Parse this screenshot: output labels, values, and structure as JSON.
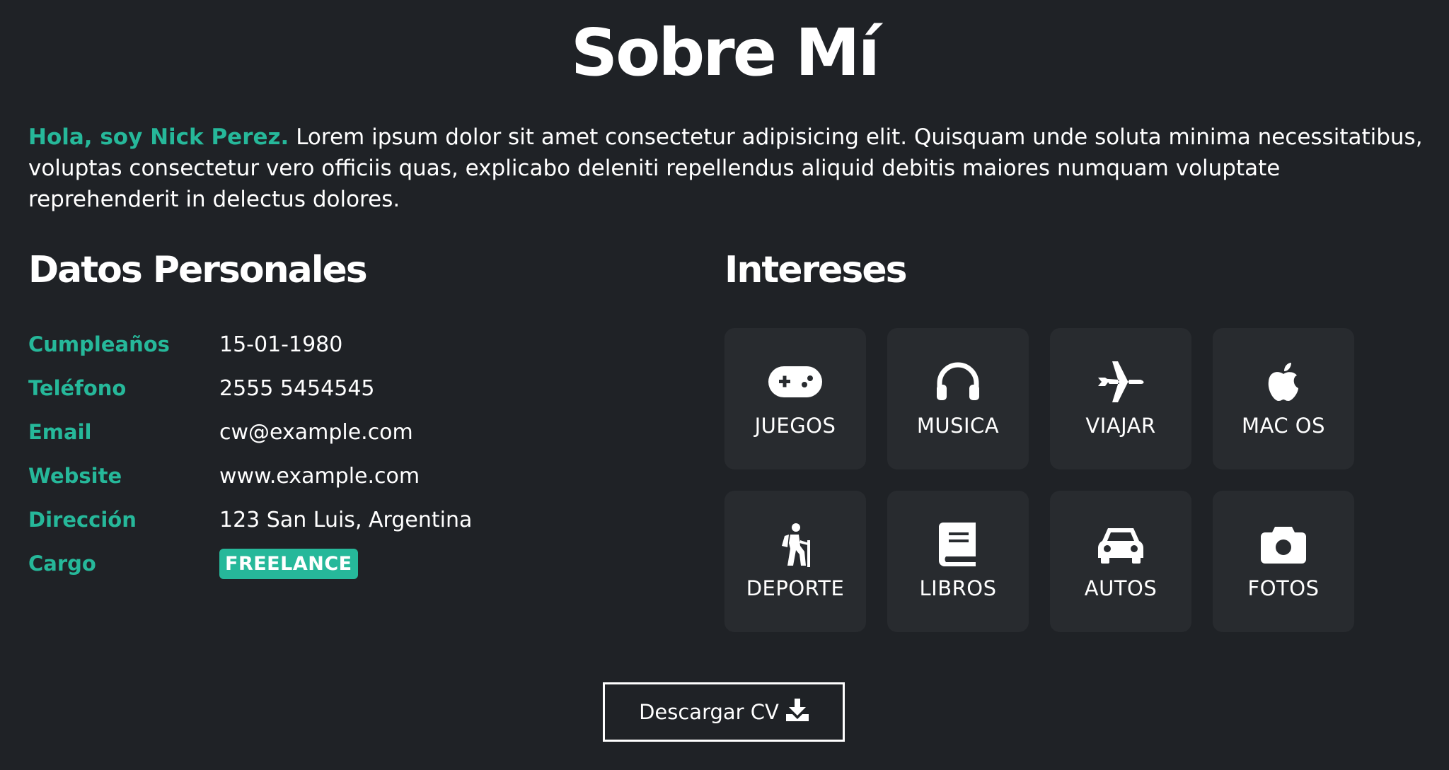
{
  "title": "Sobre Mí",
  "intro": {
    "highlight": "Hola, soy Nick Perez.",
    "text": " Lorem ipsum dolor sit amet consectetur adipisicing elit. Quisquam unde soluta minima necessitatibus, voluptas consectetur vero officiis quas, explicabo deleniti repellendus aliquid debitis maiores numquam voluptate reprehenderit in delectus dolores."
  },
  "personal": {
    "heading": "Datos Personales",
    "rows": [
      {
        "label": "Cumpleaños",
        "value": "15-01-1980"
      },
      {
        "label": "Teléfono",
        "value": "2555 5454545"
      },
      {
        "label": "Email",
        "value": "cw@example.com"
      },
      {
        "label": "Website",
        "value": "www.example.com"
      },
      {
        "label": "Dirección",
        "value": "123 San Luis, Argentina"
      },
      {
        "label": "Cargo",
        "value": "FREELANCE"
      }
    ]
  },
  "interests": {
    "heading": "Intereses",
    "items": [
      {
        "label": "JUEGOS",
        "icon": "gamepad-icon"
      },
      {
        "label": "MUSICA",
        "icon": "headphones-icon"
      },
      {
        "label": "VIAJAR",
        "icon": "plane-icon"
      },
      {
        "label": "MAC OS",
        "icon": "apple-icon"
      },
      {
        "label": "DEPORTE",
        "icon": "hiking-icon"
      },
      {
        "label": "LIBROS",
        "icon": "book-icon"
      },
      {
        "label": "AUTOS",
        "icon": "car-icon"
      },
      {
        "label": "FOTOS",
        "icon": "camera-icon"
      }
    ]
  },
  "cv_button": {
    "label": "Descargar CV",
    "icon": "download-icon"
  },
  "colors": {
    "accent": "#26b89a",
    "background": "#1f2226",
    "card": "#282b2f"
  }
}
